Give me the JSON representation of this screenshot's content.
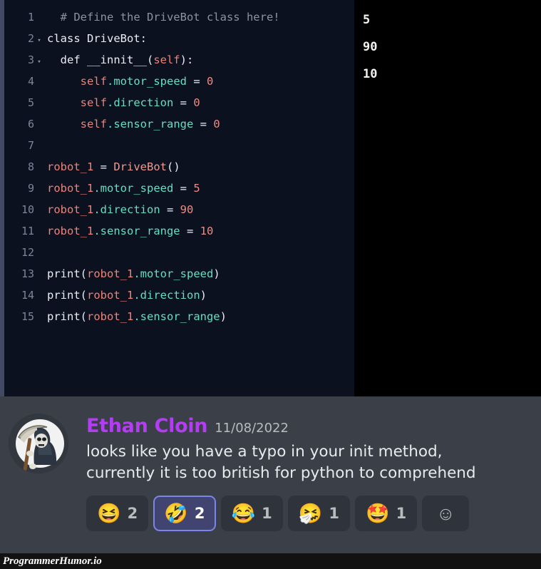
{
  "editor": {
    "lines": [
      {
        "number": "1",
        "fold": "",
        "tokens": [
          {
            "t": "  # Define the DriveBot class here!",
            "c": "tok-comment"
          }
        ]
      },
      {
        "number": "2",
        "fold": "▾",
        "tokens": [
          {
            "t": "class DriveBot:",
            "c": "tok-plain"
          }
        ]
      },
      {
        "number": "3",
        "fold": "▾",
        "tokens": [
          {
            "t": "  def __innit__(",
            "c": "tok-plain"
          },
          {
            "t": "self",
            "c": "tok-self"
          },
          {
            "t": "):",
            "c": "tok-punc"
          }
        ]
      },
      {
        "number": "4",
        "fold": "",
        "tokens": [
          {
            "t": "     ",
            "c": "tok-plain"
          },
          {
            "t": "self",
            "c": "tok-self"
          },
          {
            "t": ".motor_speed",
            "c": "tok-attr"
          },
          {
            "t": " = ",
            "c": "tok-op"
          },
          {
            "t": "0",
            "c": "tok-num"
          }
        ]
      },
      {
        "number": "5",
        "fold": "",
        "tokens": [
          {
            "t": "     ",
            "c": "tok-plain"
          },
          {
            "t": "self",
            "c": "tok-self"
          },
          {
            "t": ".direction",
            "c": "tok-attr"
          },
          {
            "t": " = ",
            "c": "tok-op"
          },
          {
            "t": "0",
            "c": "tok-num"
          }
        ]
      },
      {
        "number": "6",
        "fold": "",
        "tokens": [
          {
            "t": "     ",
            "c": "tok-plain"
          },
          {
            "t": "self",
            "c": "tok-self"
          },
          {
            "t": ".sensor_range",
            "c": "tok-attr"
          },
          {
            "t": " = ",
            "c": "tok-op"
          },
          {
            "t": "0",
            "c": "tok-num"
          }
        ]
      },
      {
        "number": "7",
        "fold": "",
        "tokens": [
          {
            "t": "",
            "c": "tok-plain"
          }
        ]
      },
      {
        "number": "8",
        "fold": "",
        "tokens": [
          {
            "t": "robot_1",
            "c": "tok-var"
          },
          {
            "t": " = ",
            "c": "tok-op"
          },
          {
            "t": "DriveBot",
            "c": "tok-class"
          },
          {
            "t": "()",
            "c": "tok-punc"
          }
        ]
      },
      {
        "number": "9",
        "fold": "",
        "tokens": [
          {
            "t": "robot_1",
            "c": "tok-var"
          },
          {
            "t": ".motor_speed",
            "c": "tok-attr"
          },
          {
            "t": " = ",
            "c": "tok-op"
          },
          {
            "t": "5",
            "c": "tok-num"
          }
        ]
      },
      {
        "number": "10",
        "fold": "",
        "tokens": [
          {
            "t": "robot_1",
            "c": "tok-var"
          },
          {
            "t": ".direction",
            "c": "tok-attr"
          },
          {
            "t": " = ",
            "c": "tok-op"
          },
          {
            "t": "90",
            "c": "tok-num"
          }
        ]
      },
      {
        "number": "11",
        "fold": "",
        "tokens": [
          {
            "t": "robot_1",
            "c": "tok-var"
          },
          {
            "t": ".sensor_range",
            "c": "tok-attr"
          },
          {
            "t": " = ",
            "c": "tok-op"
          },
          {
            "t": "10",
            "c": "tok-num"
          }
        ]
      },
      {
        "number": "12",
        "fold": "",
        "tokens": [
          {
            "t": "",
            "c": "tok-plain"
          }
        ]
      },
      {
        "number": "13",
        "fold": "",
        "tokens": [
          {
            "t": "print(",
            "c": "tok-func"
          },
          {
            "t": "robot_1",
            "c": "tok-var"
          },
          {
            "t": ".motor_speed",
            "c": "tok-attr"
          },
          {
            "t": ")",
            "c": "tok-punc"
          }
        ]
      },
      {
        "number": "14",
        "fold": "",
        "tokens": [
          {
            "t": "print(",
            "c": "tok-func"
          },
          {
            "t": "robot_1",
            "c": "tok-var"
          },
          {
            "t": ".direction",
            "c": "tok-attr"
          },
          {
            "t": ")",
            "c": "tok-punc"
          }
        ]
      },
      {
        "number": "15",
        "fold": "",
        "tokens": [
          {
            "t": "print(",
            "c": "tok-func"
          },
          {
            "t": "robot_1",
            "c": "tok-var"
          },
          {
            "t": ".sensor_range",
            "c": "tok-attr"
          },
          {
            "t": ")",
            "c": "tok-punc"
          }
        ]
      }
    ]
  },
  "output": {
    "lines": [
      "5",
      "90",
      "10"
    ]
  },
  "message": {
    "author": "Ethan Cloin",
    "author_color": "#b33df0",
    "timestamp": "11/08/2022",
    "avatar_alt": "grim-reaper-avatar",
    "text_lines": [
      "looks like you have a typo in your init method,",
      "currently it is too british for python to comprehend"
    ]
  },
  "reactions": [
    {
      "emoji": "😆",
      "name": "grinning-squinting-face",
      "count": "2",
      "selected": false
    },
    {
      "emoji": "🤣",
      "name": "rolling-on-the-floor-laughing",
      "count": "2",
      "selected": true
    },
    {
      "emoji": "😂",
      "name": "face-with-tears-of-joy",
      "count": "1",
      "selected": false
    },
    {
      "emoji": "🤧",
      "name": "sneezing-face",
      "count": "1",
      "selected": false
    },
    {
      "emoji": "🤩",
      "name": "star-struck",
      "count": "1",
      "selected": false
    }
  ],
  "add_reaction": {
    "emoji": "☺",
    "name": "add-reaction-icon"
  },
  "watermark": {
    "text": "ProgrammerHumor.io"
  }
}
